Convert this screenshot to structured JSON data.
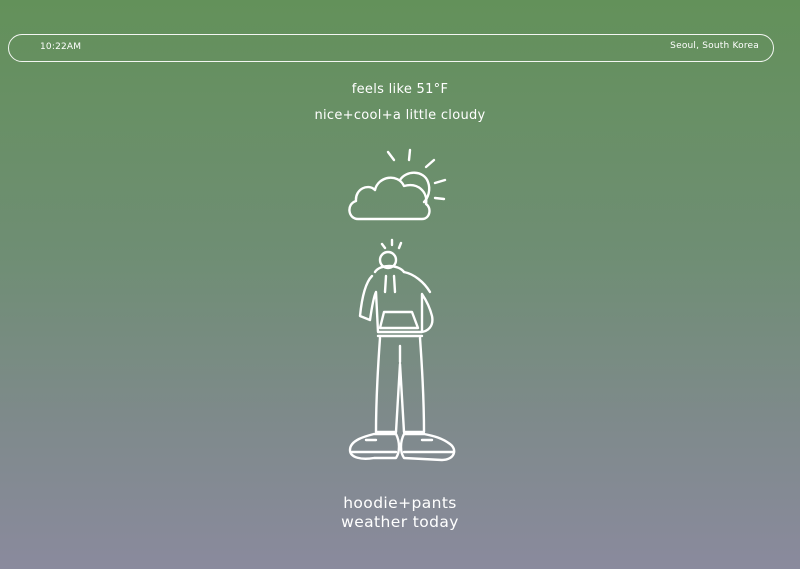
{
  "header": {
    "time": "10:22AM",
    "location": "Seoul, South Korea"
  },
  "weather": {
    "feels_like": "feels like 51°F",
    "description": "nice+cool+a little cloudy",
    "icon": "partly-cloudy-icon"
  },
  "outfit": {
    "recommendation": "hoodie+pants",
    "subtitle": "weather today",
    "illustration": "person-in-hoodie-illustration"
  },
  "colors": {
    "gradient_top": "#63915a",
    "gradient_bottom": "#8a8a9d",
    "foreground": "#ffffff"
  }
}
